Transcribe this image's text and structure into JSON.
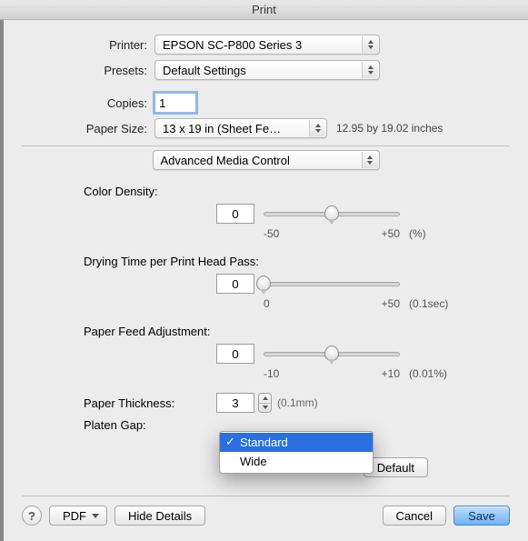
{
  "window": {
    "title": "Print"
  },
  "labels": {
    "printer": "Printer:",
    "presets": "Presets:",
    "copies": "Copies:",
    "paper_size": "Paper Size:",
    "color_density": "Color Density:",
    "drying_time": "Drying Time per Print Head Pass:",
    "paper_feed": "Paper Feed Adjustment:",
    "paper_thickness": "Paper Thickness:",
    "platen_gap": "Platen Gap:"
  },
  "printer_select": "EPSON SC-P800 Series 3",
  "presets_select": "Default Settings",
  "copies_value": "1",
  "paper_size_select": "13 x 19 in (Sheet Fe…",
  "paper_size_dims": "12.95 by 19.02 inches",
  "pane_select": "Advanced Media Control",
  "color_density": {
    "value": "0",
    "min": "-50",
    "max": "+50",
    "unit": "(%)"
  },
  "drying_time": {
    "value": "0",
    "min": "0",
    "max": "+50",
    "unit": "(0.1sec)"
  },
  "paper_feed": {
    "value": "0",
    "min": "-10",
    "max": "+10",
    "unit": "(0.01%)"
  },
  "paper_thickness": {
    "value": "3",
    "unit": "(0.1mm)"
  },
  "platen_gap": {
    "options": [
      "Standard",
      "Wide"
    ],
    "selected": "Standard"
  },
  "buttons": {
    "default": "Default",
    "help": "?",
    "pdf": "PDF",
    "hide_details": "Hide Details",
    "cancel": "Cancel",
    "save": "Save"
  },
  "colors": {
    "accent": "#2a6fe0"
  }
}
